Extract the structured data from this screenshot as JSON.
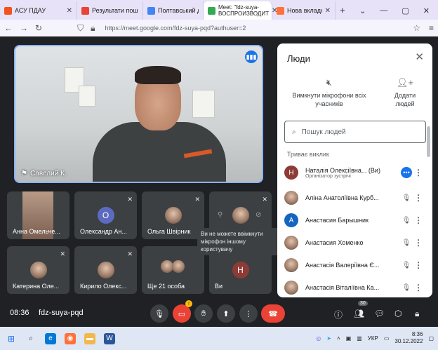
{
  "browser": {
    "tabs": [
      {
        "title": "АСУ ПДАУ",
        "active": false,
        "color": "#f4511e"
      },
      {
        "title": "Результати пош",
        "active": false,
        "color": "#ea4335"
      },
      {
        "title": "Полтавський дер",
        "active": false,
        "color": "#4285f4"
      },
      {
        "title": "Meet: \"fdz-suya-",
        "subtitle": "ВОСПРОИЗВОДИТ",
        "active": true,
        "color": "#34a853"
      },
      {
        "title": "Нова вкладка",
        "active": false,
        "color": "#ff7139"
      }
    ],
    "url": "https://meet.google.com/fdz-suya-pqd?authuser=2"
  },
  "meet": {
    "main_speaker": {
      "name": "Савелий К."
    },
    "tiles": [
      {
        "name": "Анна Омельче...",
        "avatar_letter": "",
        "avatar_color": ""
      },
      {
        "name": "Олександр Ан...",
        "avatar_letter": "О",
        "avatar_color": "#5c6bc0"
      },
      {
        "name": "Ольга Швірник",
        "avatar_letter": "",
        "avatar_color": ""
      },
      {
        "name": "",
        "avatar_letter": "",
        "avatar_color": ""
      },
      {
        "name": "Катерина Оле...",
        "avatar_letter": "",
        "avatar_color": ""
      },
      {
        "name": "Кирило Олекс...",
        "avatar_letter": "",
        "avatar_color": ""
      },
      {
        "name": "Ще 21 особа",
        "avatar_letter": "",
        "avatar_color": ""
      },
      {
        "name": "Ви",
        "avatar_letter": "Н",
        "avatar_color": "#8d3b36"
      }
    ],
    "tooltip": "Ви не можете ввімкнути мікрофон іншому користувачу",
    "meeting_time": "08:36",
    "meeting_code": "fdz-suya-pqd",
    "participants_count": "30",
    "mic_badge": "!"
  },
  "people_panel": {
    "title": "Люди",
    "mute_all_label_1": "Вимкнути мікрофони всіх",
    "mute_all_label_2": "учасників",
    "add_people_label_1": "Додати",
    "add_people_label_2": "людей",
    "search_placeholder": "Пошук людей",
    "section_label": "Триває виклик",
    "participants": [
      {
        "name": "Наталія Олексіївна... (Ви)",
        "role": "Організатор зустрічі",
        "avatar_letter": "Н",
        "avatar_color": "#8d3b36"
      },
      {
        "name": "Аліна Анатоліївна Курб...",
        "role": "",
        "avatar_letter": "",
        "avatar_color": ""
      },
      {
        "name": "Анастасия Барышник",
        "role": "",
        "avatar_letter": "А",
        "avatar_color": "#1565c0"
      },
      {
        "name": "Анастасия Хоменко",
        "role": "",
        "avatar_letter": "",
        "avatar_color": ""
      },
      {
        "name": "Анастасія Валеріївна Є...",
        "role": "",
        "avatar_letter": "",
        "avatar_color": ""
      },
      {
        "name": "Анастасія Віталіївна Ка...",
        "role": "",
        "avatar_letter": "",
        "avatar_color": ""
      }
    ]
  },
  "taskbar": {
    "lang": "УКР",
    "time": "8:36",
    "date": "30.12.2022"
  }
}
